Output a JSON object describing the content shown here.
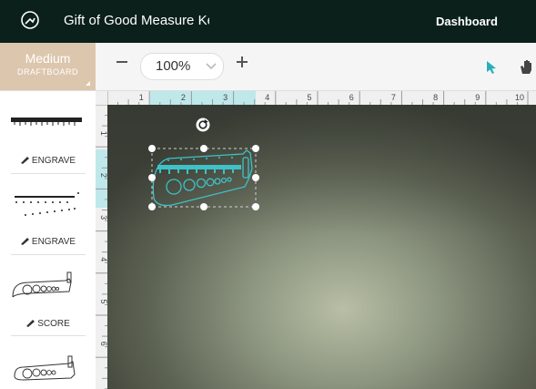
{
  "header": {
    "title": "Gift of Good Measure Ke",
    "dashboard_label": "Dashboard",
    "logo_icon": "glowforge-logo-icon"
  },
  "toolbar": {
    "material_name": "Medium",
    "material_type": "DRAFTBOARD",
    "zoom_value": "100%",
    "zoom_out_icon": "minus-icon",
    "zoom_in_icon": "plus-icon",
    "select_tool_icon": "cursor-arrow-icon",
    "pan_tool_icon": "hand-icon"
  },
  "sidebar": {
    "operations": [
      {
        "label": "ENGRAVE"
      },
      {
        "label": "ENGRAVE"
      },
      {
        "label": "SCORE"
      }
    ]
  },
  "rulers": {
    "horizontal": [
      "1",
      "2",
      "3",
      "4",
      "5",
      "6",
      "7",
      "8",
      "9",
      "10"
    ],
    "vertical": [
      "1",
      "2",
      "3",
      "4",
      "5",
      "6"
    ]
  },
  "colors": {
    "topbar": "#0b201a",
    "accent": "#3fc1c9",
    "material": "#dcc6ad"
  }
}
